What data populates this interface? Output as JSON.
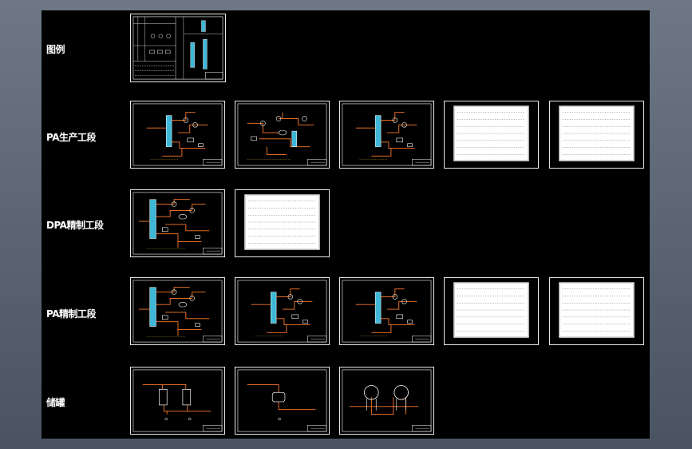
{
  "rows": [
    {
      "label": "图例",
      "sheets": [
        {
          "kind": "legend"
        }
      ]
    },
    {
      "label": "PA生产工段",
      "sheets": [
        {
          "kind": "process-column"
        },
        {
          "kind": "process-complex"
        },
        {
          "kind": "process-column"
        },
        {
          "kind": "table"
        },
        {
          "kind": "table"
        }
      ]
    },
    {
      "label": "DPA精制工段",
      "sheets": [
        {
          "kind": "process-big-column"
        },
        {
          "kind": "table"
        }
      ]
    },
    {
      "label": "PA精制工段",
      "sheets": [
        {
          "kind": "process-big-column"
        },
        {
          "kind": "process-column-cyan"
        },
        {
          "kind": "process-column-cyan"
        },
        {
          "kind": "table"
        },
        {
          "kind": "table"
        }
      ]
    },
    {
      "label": "储罐",
      "sheets": [
        {
          "kind": "tanks-square"
        },
        {
          "kind": "tank-horizontal"
        },
        {
          "kind": "tanks-spherical"
        }
      ]
    }
  ],
  "colors": {
    "background": "#000000",
    "sheet_border": "#e8e8e8",
    "pipe": "#ff7a2a",
    "equipment": "#ffffff",
    "column_fill": "#3fb8d8",
    "annotation": "#f0c040"
  }
}
